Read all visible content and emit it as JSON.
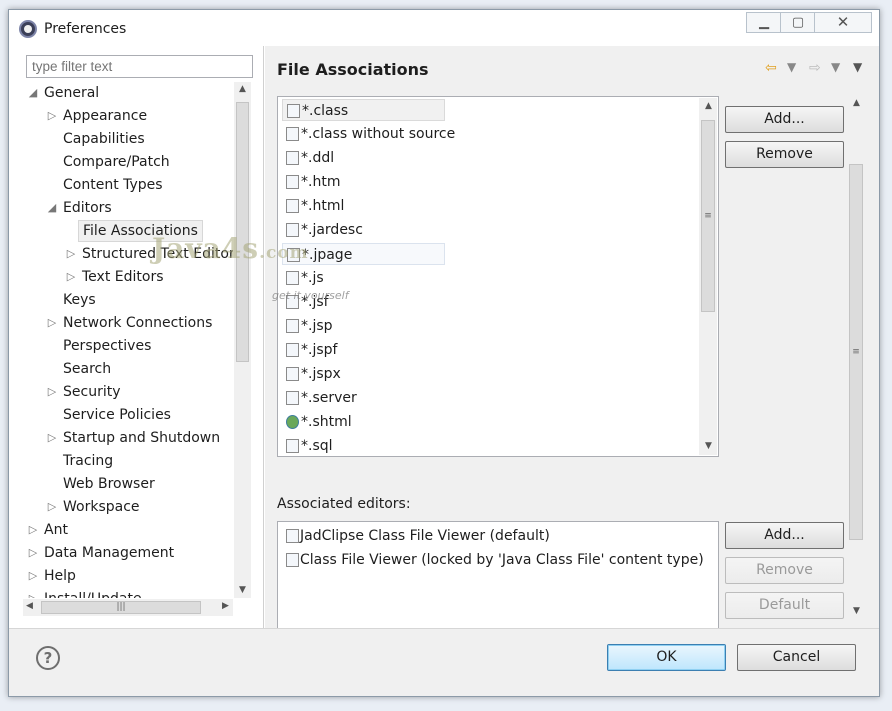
{
  "window": {
    "title": "Preferences"
  },
  "filter": {
    "placeholder": "type filter text"
  },
  "tree": {
    "items": [
      {
        "label": "General",
        "level": 0,
        "expand": "open"
      },
      {
        "label": "Appearance",
        "level": 1,
        "expand": "closed"
      },
      {
        "label": "Capabilities",
        "level": 1,
        "expand": "none"
      },
      {
        "label": "Compare/Patch",
        "level": 1,
        "expand": "none"
      },
      {
        "label": "Content Types",
        "level": 1,
        "expand": "none"
      },
      {
        "label": "Editors",
        "level": 1,
        "expand": "open"
      },
      {
        "label": "File Associations",
        "level": 2,
        "expand": "none",
        "selected": true
      },
      {
        "label": "Structured Text Editor",
        "level": 2,
        "expand": "closed"
      },
      {
        "label": "Text Editors",
        "level": 2,
        "expand": "closed"
      },
      {
        "label": "Keys",
        "level": 1,
        "expand": "none"
      },
      {
        "label": "Network Connections",
        "level": 1,
        "expand": "closed"
      },
      {
        "label": "Perspectives",
        "level": 1,
        "expand": "none"
      },
      {
        "label": "Search",
        "level": 1,
        "expand": "none"
      },
      {
        "label": "Security",
        "level": 1,
        "expand": "closed"
      },
      {
        "label": "Service Policies",
        "level": 1,
        "expand": "none"
      },
      {
        "label": "Startup and Shutdown",
        "level": 1,
        "expand": "closed"
      },
      {
        "label": "Tracing",
        "level": 1,
        "expand": "none"
      },
      {
        "label": "Web Browser",
        "level": 1,
        "expand": "none"
      },
      {
        "label": "Workspace",
        "level": 1,
        "expand": "closed"
      },
      {
        "label": "Ant",
        "level": 0,
        "expand": "closed"
      },
      {
        "label": "Data Management",
        "level": 0,
        "expand": "closed"
      },
      {
        "label": "Help",
        "level": 0,
        "expand": "closed"
      },
      {
        "label": "Install/Update",
        "level": 0,
        "expand": "closed"
      }
    ]
  },
  "page": {
    "title": "File Associations"
  },
  "file_types": {
    "items": [
      {
        "label": "*.class",
        "icon": "class-file-icon",
        "selected": true
      },
      {
        "label": "*.class without source",
        "icon": "class-file-icon"
      },
      {
        "label": "*.ddl",
        "icon": "ddl-file-icon"
      },
      {
        "label": "*.htm",
        "icon": "html-file-icon"
      },
      {
        "label": "*.html",
        "icon": "html-file-icon"
      },
      {
        "label": "*.jardesc",
        "icon": "jardesc-file-icon"
      },
      {
        "label": "*.jpage",
        "icon": "jpage-file-icon",
        "hover": true
      },
      {
        "label": "*.js",
        "icon": "js-file-icon"
      },
      {
        "label": "*.jsf",
        "icon": "jsf-file-icon"
      },
      {
        "label": "*.jsp",
        "icon": "jsp-file-icon"
      },
      {
        "label": "*.jspf",
        "icon": "jspf-file-icon"
      },
      {
        "label": "*.jspx",
        "icon": "jspx-file-icon"
      },
      {
        "label": "*.server",
        "icon": "server-file-icon"
      },
      {
        "label": "*.shtml",
        "icon": "globe-icon"
      },
      {
        "label": "*.sql",
        "icon": "sql-file-icon"
      }
    ],
    "add_label": "Add...",
    "remove_label": "Remove"
  },
  "associated_editors": {
    "label": "Associated editors:",
    "items": [
      {
        "label": "JadClipse Class File Viewer (default)"
      },
      {
        "label": "Class File Viewer (locked by 'Java Class File' content type)"
      }
    ],
    "add_label": "Add...",
    "remove_label": "Remove",
    "default_label": "Default"
  },
  "footer": {
    "ok_label": "OK",
    "cancel_label": "Cancel"
  },
  "watermark": {
    "brand": "Java4s",
    "domain": ".com",
    "tagline": "get it yourself"
  },
  "colors": {
    "selection": "#f1f1f1",
    "primary_button_border": "#3c7fb1",
    "disabled_text": "#9a9a9a"
  }
}
